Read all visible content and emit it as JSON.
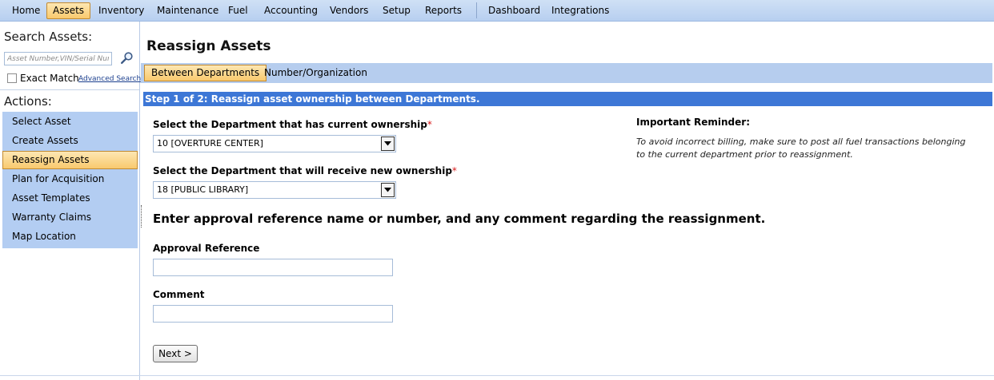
{
  "menu": {
    "items": [
      {
        "label": "Home"
      },
      {
        "label": "Assets",
        "active": true
      },
      {
        "label": "Inventory"
      },
      {
        "label": "Maintenance"
      },
      {
        "label": "Fuel"
      },
      {
        "label": "Accounting"
      },
      {
        "label": "Vendors"
      },
      {
        "label": "Setup"
      },
      {
        "label": "Reports"
      },
      {
        "label": "Dashboard"
      },
      {
        "label": "Integrations"
      }
    ]
  },
  "sidebar": {
    "search_title": "Search Assets:",
    "search_placeholder": "Asset Number,VIN/Serial Number",
    "search_icon": "magnifier-icon",
    "exact_match_label": "Exact Match",
    "exact_match_checked": false,
    "advanced_search_label": "Advanced Search",
    "actions_title": "Actions:",
    "actions": [
      {
        "label": "Select Asset"
      },
      {
        "label": "Create Assets"
      },
      {
        "label": "Reassign Assets",
        "active": true
      },
      {
        "label": "Plan for Acquisition"
      },
      {
        "label": "Asset Templates"
      },
      {
        "label": "Warranty Claims"
      },
      {
        "label": "Map Location"
      }
    ]
  },
  "main": {
    "title": "Reassign Assets",
    "tabs": [
      {
        "label": "Between Departments",
        "active": true
      },
      {
        "label": "Number/Organization"
      }
    ],
    "step_text": "Step 1 of 2: Reassign asset ownership between Departments.",
    "current_dept": {
      "label": "Select the Department that has current ownership",
      "required_marker": "*",
      "value": "10 [OVERTURE CENTER]"
    },
    "new_dept": {
      "label": "Select the Department that will receive new ownership",
      "required_marker": "*",
      "value": "18 [PUBLIC LIBRARY]"
    },
    "reminder": {
      "title": "Important Reminder:",
      "text": "To avoid incorrect billing, make sure to post all fuel transactions belonging to the current department prior to reassignment."
    },
    "approval_heading": "Enter approval reference name or number, and any comment regarding the reassignment.",
    "approval_reference": {
      "label": "Approval Reference",
      "value": ""
    },
    "comment": {
      "label": "Comment",
      "value": ""
    },
    "next_button": "Next >"
  },
  "colors": {
    "menu_bar": "#b7cff0",
    "active_highlight": "#f9c96d",
    "step_bar": "#3d77d6",
    "actions_bg": "#b3cdf2",
    "required": "#d81b1b"
  }
}
